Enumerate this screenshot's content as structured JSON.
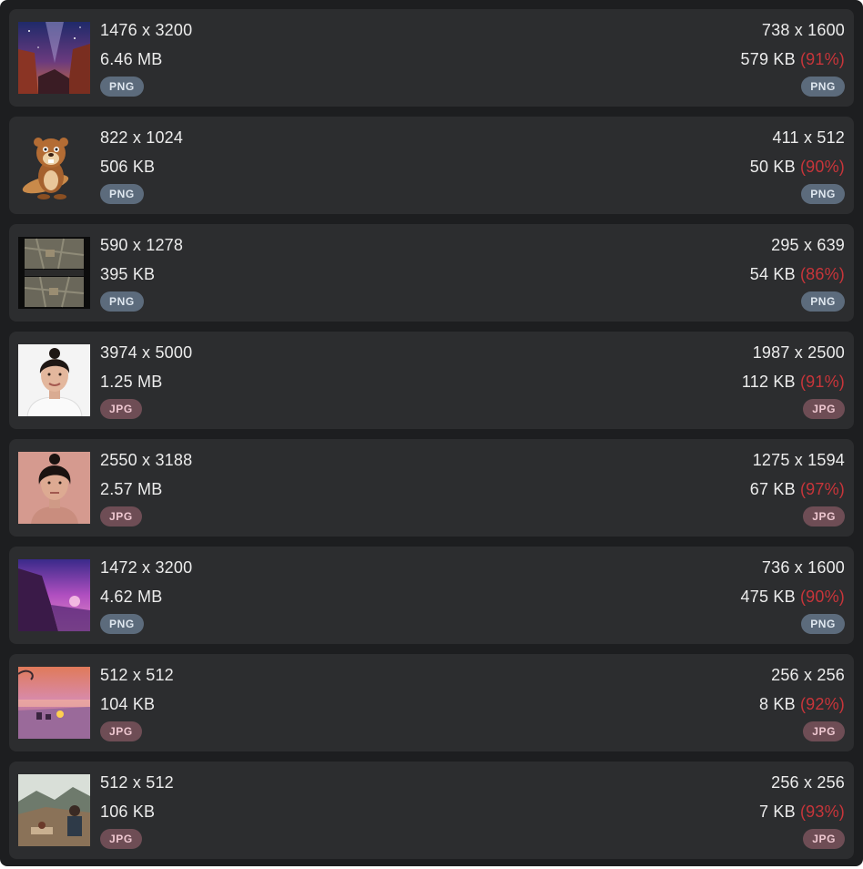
{
  "items": [
    {
      "thumb": "night-sky-canyon",
      "original_dims": "1476 x 3200",
      "original_size": "6.46 MB",
      "format": "PNG",
      "compressed_dims": "738 x 1600",
      "compressed_size": "579 KB",
      "savings": "(91%)"
    },
    {
      "thumb": "cartoon-beaver",
      "original_dims": "822 x 1024",
      "original_size": "506 KB",
      "format": "PNG",
      "compressed_dims": "411 x 512",
      "compressed_size": "50 KB",
      "savings": "(90%)"
    },
    {
      "thumb": "satellite-map",
      "original_dims": "590 x 1278",
      "original_size": "395 KB",
      "format": "PNG",
      "compressed_dims": "295 x 639",
      "compressed_size": "54 KB",
      "savings": "(86%)"
    },
    {
      "thumb": "woman-portrait-white",
      "original_dims": "3974 x 5000",
      "original_size": "1.25 MB",
      "format": "JPG",
      "compressed_dims": "1987 x 2500",
      "compressed_size": "112 KB",
      "savings": "(91%)"
    },
    {
      "thumb": "woman-portrait-pink",
      "original_dims": "2550 x 3188",
      "original_size": "2.57 MB",
      "format": "JPG",
      "compressed_dims": "1275 x 1594",
      "compressed_size": "67 KB",
      "savings": "(97%)"
    },
    {
      "thumb": "purple-coast-sunset",
      "original_dims": "1472 x 3200",
      "original_size": "4.62 MB",
      "format": "PNG",
      "compressed_dims": "736 x 1600",
      "compressed_size": "475 KB",
      "savings": "(90%)"
    },
    {
      "thumb": "beach-campfire-sunset",
      "original_dims": "512 x 512",
      "original_size": "104 KB",
      "format": "JPG",
      "compressed_dims": "256 x 256",
      "compressed_size": "8 KB",
      "savings": "(92%)"
    },
    {
      "thumb": "mountain-picnic",
      "original_dims": "512 x 512",
      "original_size": "106 KB",
      "format": "JPG",
      "compressed_dims": "256 x 256",
      "compressed_size": "7 KB",
      "savings": "(93%)"
    }
  ]
}
